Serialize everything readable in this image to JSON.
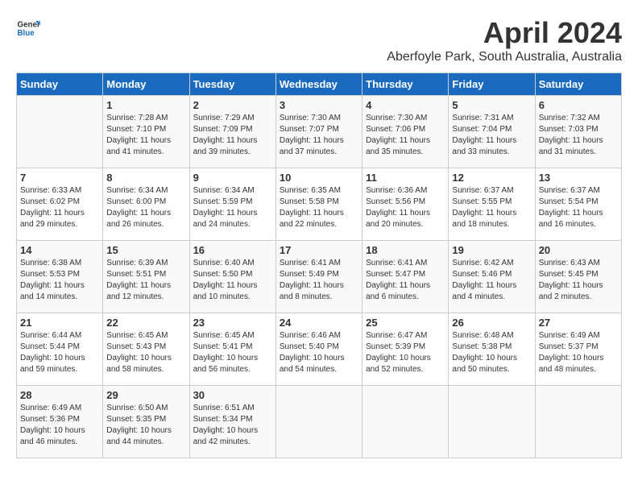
{
  "header": {
    "logo_general": "General",
    "logo_blue": "Blue",
    "month": "April 2024",
    "location": "Aberfoyle Park, South Australia, Australia"
  },
  "calendar": {
    "days_of_week": [
      "Sunday",
      "Monday",
      "Tuesday",
      "Wednesday",
      "Thursday",
      "Friday",
      "Saturday"
    ],
    "weeks": [
      [
        {
          "day": "",
          "sunrise": "",
          "sunset": "",
          "daylight": ""
        },
        {
          "day": "1",
          "sunrise": "Sunrise: 7:28 AM",
          "sunset": "Sunset: 7:10 PM",
          "daylight": "Daylight: 11 hours and 41 minutes."
        },
        {
          "day": "2",
          "sunrise": "Sunrise: 7:29 AM",
          "sunset": "Sunset: 7:09 PM",
          "daylight": "Daylight: 11 hours and 39 minutes."
        },
        {
          "day": "3",
          "sunrise": "Sunrise: 7:30 AM",
          "sunset": "Sunset: 7:07 PM",
          "daylight": "Daylight: 11 hours and 37 minutes."
        },
        {
          "day": "4",
          "sunrise": "Sunrise: 7:30 AM",
          "sunset": "Sunset: 7:06 PM",
          "daylight": "Daylight: 11 hours and 35 minutes."
        },
        {
          "day": "5",
          "sunrise": "Sunrise: 7:31 AM",
          "sunset": "Sunset: 7:04 PM",
          "daylight": "Daylight: 11 hours and 33 minutes."
        },
        {
          "day": "6",
          "sunrise": "Sunrise: 7:32 AM",
          "sunset": "Sunset: 7:03 PM",
          "daylight": "Daylight: 11 hours and 31 minutes."
        }
      ],
      [
        {
          "day": "7",
          "sunrise": "Sunrise: 6:33 AM",
          "sunset": "Sunset: 6:02 PM",
          "daylight": "Daylight: 11 hours and 29 minutes."
        },
        {
          "day": "8",
          "sunrise": "Sunrise: 6:34 AM",
          "sunset": "Sunset: 6:00 PM",
          "daylight": "Daylight: 11 hours and 26 minutes."
        },
        {
          "day": "9",
          "sunrise": "Sunrise: 6:34 AM",
          "sunset": "Sunset: 5:59 PM",
          "daylight": "Daylight: 11 hours and 24 minutes."
        },
        {
          "day": "10",
          "sunrise": "Sunrise: 6:35 AM",
          "sunset": "Sunset: 5:58 PM",
          "daylight": "Daylight: 11 hours and 22 minutes."
        },
        {
          "day": "11",
          "sunrise": "Sunrise: 6:36 AM",
          "sunset": "Sunset: 5:56 PM",
          "daylight": "Daylight: 11 hours and 20 minutes."
        },
        {
          "day": "12",
          "sunrise": "Sunrise: 6:37 AM",
          "sunset": "Sunset: 5:55 PM",
          "daylight": "Daylight: 11 hours and 18 minutes."
        },
        {
          "day": "13",
          "sunrise": "Sunrise: 6:37 AM",
          "sunset": "Sunset: 5:54 PM",
          "daylight": "Daylight: 11 hours and 16 minutes."
        }
      ],
      [
        {
          "day": "14",
          "sunrise": "Sunrise: 6:38 AM",
          "sunset": "Sunset: 5:53 PM",
          "daylight": "Daylight: 11 hours and 14 minutes."
        },
        {
          "day": "15",
          "sunrise": "Sunrise: 6:39 AM",
          "sunset": "Sunset: 5:51 PM",
          "daylight": "Daylight: 11 hours and 12 minutes."
        },
        {
          "day": "16",
          "sunrise": "Sunrise: 6:40 AM",
          "sunset": "Sunset: 5:50 PM",
          "daylight": "Daylight: 11 hours and 10 minutes."
        },
        {
          "day": "17",
          "sunrise": "Sunrise: 6:41 AM",
          "sunset": "Sunset: 5:49 PM",
          "daylight": "Daylight: 11 hours and 8 minutes."
        },
        {
          "day": "18",
          "sunrise": "Sunrise: 6:41 AM",
          "sunset": "Sunset: 5:47 PM",
          "daylight": "Daylight: 11 hours and 6 minutes."
        },
        {
          "day": "19",
          "sunrise": "Sunrise: 6:42 AM",
          "sunset": "Sunset: 5:46 PM",
          "daylight": "Daylight: 11 hours and 4 minutes."
        },
        {
          "day": "20",
          "sunrise": "Sunrise: 6:43 AM",
          "sunset": "Sunset: 5:45 PM",
          "daylight": "Daylight: 11 hours and 2 minutes."
        }
      ],
      [
        {
          "day": "21",
          "sunrise": "Sunrise: 6:44 AM",
          "sunset": "Sunset: 5:44 PM",
          "daylight": "Daylight: 10 hours and 59 minutes."
        },
        {
          "day": "22",
          "sunrise": "Sunrise: 6:45 AM",
          "sunset": "Sunset: 5:43 PM",
          "daylight": "Daylight: 10 hours and 58 minutes."
        },
        {
          "day": "23",
          "sunrise": "Sunrise: 6:45 AM",
          "sunset": "Sunset: 5:41 PM",
          "daylight": "Daylight: 10 hours and 56 minutes."
        },
        {
          "day": "24",
          "sunrise": "Sunrise: 6:46 AM",
          "sunset": "Sunset: 5:40 PM",
          "daylight": "Daylight: 10 hours and 54 minutes."
        },
        {
          "day": "25",
          "sunrise": "Sunrise: 6:47 AM",
          "sunset": "Sunset: 5:39 PM",
          "daylight": "Daylight: 10 hours and 52 minutes."
        },
        {
          "day": "26",
          "sunrise": "Sunrise: 6:48 AM",
          "sunset": "Sunset: 5:38 PM",
          "daylight": "Daylight: 10 hours and 50 minutes."
        },
        {
          "day": "27",
          "sunrise": "Sunrise: 6:49 AM",
          "sunset": "Sunset: 5:37 PM",
          "daylight": "Daylight: 10 hours and 48 minutes."
        }
      ],
      [
        {
          "day": "28",
          "sunrise": "Sunrise: 6:49 AM",
          "sunset": "Sunset: 5:36 PM",
          "daylight": "Daylight: 10 hours and 46 minutes."
        },
        {
          "day": "29",
          "sunrise": "Sunrise: 6:50 AM",
          "sunset": "Sunset: 5:35 PM",
          "daylight": "Daylight: 10 hours and 44 minutes."
        },
        {
          "day": "30",
          "sunrise": "Sunrise: 6:51 AM",
          "sunset": "Sunset: 5:34 PM",
          "daylight": "Daylight: 10 hours and 42 minutes."
        },
        {
          "day": "",
          "sunrise": "",
          "sunset": "",
          "daylight": ""
        },
        {
          "day": "",
          "sunrise": "",
          "sunset": "",
          "daylight": ""
        },
        {
          "day": "",
          "sunrise": "",
          "sunset": "",
          "daylight": ""
        },
        {
          "day": "",
          "sunrise": "",
          "sunset": "",
          "daylight": ""
        }
      ]
    ]
  }
}
